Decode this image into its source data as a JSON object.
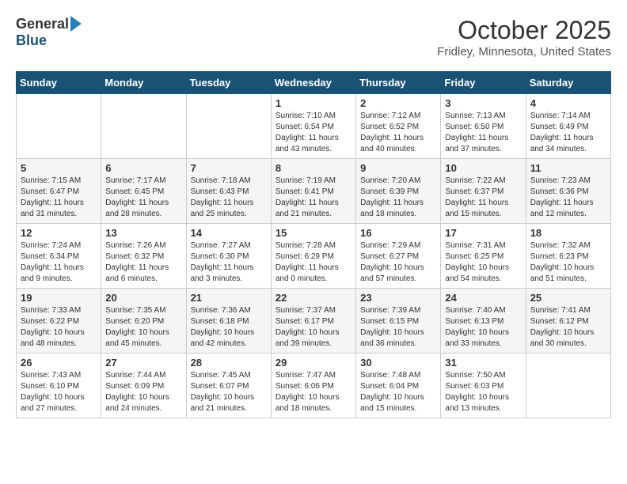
{
  "header": {
    "logo_general": "General",
    "logo_blue": "Blue",
    "month_title": "October 2025",
    "location": "Fridley, Minnesota, United States"
  },
  "days_of_week": [
    "Sunday",
    "Monday",
    "Tuesday",
    "Wednesday",
    "Thursday",
    "Friday",
    "Saturday"
  ],
  "weeks": [
    [
      {
        "day": "",
        "info": ""
      },
      {
        "day": "",
        "info": ""
      },
      {
        "day": "",
        "info": ""
      },
      {
        "day": "1",
        "info": "Sunrise: 7:10 AM\nSunset: 6:54 PM\nDaylight: 11 hours\nand 43 minutes."
      },
      {
        "day": "2",
        "info": "Sunrise: 7:12 AM\nSunset: 6:52 PM\nDaylight: 11 hours\nand 40 minutes."
      },
      {
        "day": "3",
        "info": "Sunrise: 7:13 AM\nSunset: 6:50 PM\nDaylight: 11 hours\nand 37 minutes."
      },
      {
        "day": "4",
        "info": "Sunrise: 7:14 AM\nSunset: 6:49 PM\nDaylight: 11 hours\nand 34 minutes."
      }
    ],
    [
      {
        "day": "5",
        "info": "Sunrise: 7:15 AM\nSunset: 6:47 PM\nDaylight: 11 hours\nand 31 minutes."
      },
      {
        "day": "6",
        "info": "Sunrise: 7:17 AM\nSunset: 6:45 PM\nDaylight: 11 hours\nand 28 minutes."
      },
      {
        "day": "7",
        "info": "Sunrise: 7:18 AM\nSunset: 6:43 PM\nDaylight: 11 hours\nand 25 minutes."
      },
      {
        "day": "8",
        "info": "Sunrise: 7:19 AM\nSunset: 6:41 PM\nDaylight: 11 hours\nand 21 minutes."
      },
      {
        "day": "9",
        "info": "Sunrise: 7:20 AM\nSunset: 6:39 PM\nDaylight: 11 hours\nand 18 minutes."
      },
      {
        "day": "10",
        "info": "Sunrise: 7:22 AM\nSunset: 6:37 PM\nDaylight: 11 hours\nand 15 minutes."
      },
      {
        "day": "11",
        "info": "Sunrise: 7:23 AM\nSunset: 6:36 PM\nDaylight: 11 hours\nand 12 minutes."
      }
    ],
    [
      {
        "day": "12",
        "info": "Sunrise: 7:24 AM\nSunset: 6:34 PM\nDaylight: 11 hours\nand 9 minutes."
      },
      {
        "day": "13",
        "info": "Sunrise: 7:26 AM\nSunset: 6:32 PM\nDaylight: 11 hours\nand 6 minutes."
      },
      {
        "day": "14",
        "info": "Sunrise: 7:27 AM\nSunset: 6:30 PM\nDaylight: 11 hours\nand 3 minutes."
      },
      {
        "day": "15",
        "info": "Sunrise: 7:28 AM\nSunset: 6:29 PM\nDaylight: 11 hours\nand 0 minutes."
      },
      {
        "day": "16",
        "info": "Sunrise: 7:29 AM\nSunset: 6:27 PM\nDaylight: 10 hours\nand 57 minutes."
      },
      {
        "day": "17",
        "info": "Sunrise: 7:31 AM\nSunset: 6:25 PM\nDaylight: 10 hours\nand 54 minutes."
      },
      {
        "day": "18",
        "info": "Sunrise: 7:32 AM\nSunset: 6:23 PM\nDaylight: 10 hours\nand 51 minutes."
      }
    ],
    [
      {
        "day": "19",
        "info": "Sunrise: 7:33 AM\nSunset: 6:22 PM\nDaylight: 10 hours\nand 48 minutes."
      },
      {
        "day": "20",
        "info": "Sunrise: 7:35 AM\nSunset: 6:20 PM\nDaylight: 10 hours\nand 45 minutes."
      },
      {
        "day": "21",
        "info": "Sunrise: 7:36 AM\nSunset: 6:18 PM\nDaylight: 10 hours\nand 42 minutes."
      },
      {
        "day": "22",
        "info": "Sunrise: 7:37 AM\nSunset: 6:17 PM\nDaylight: 10 hours\nand 39 minutes."
      },
      {
        "day": "23",
        "info": "Sunrise: 7:39 AM\nSunset: 6:15 PM\nDaylight: 10 hours\nand 36 minutes."
      },
      {
        "day": "24",
        "info": "Sunrise: 7:40 AM\nSunset: 6:13 PM\nDaylight: 10 hours\nand 33 minutes."
      },
      {
        "day": "25",
        "info": "Sunrise: 7:41 AM\nSunset: 6:12 PM\nDaylight: 10 hours\nand 30 minutes."
      }
    ],
    [
      {
        "day": "26",
        "info": "Sunrise: 7:43 AM\nSunset: 6:10 PM\nDaylight: 10 hours\nand 27 minutes."
      },
      {
        "day": "27",
        "info": "Sunrise: 7:44 AM\nSunset: 6:09 PM\nDaylight: 10 hours\nand 24 minutes."
      },
      {
        "day": "28",
        "info": "Sunrise: 7:45 AM\nSunset: 6:07 PM\nDaylight: 10 hours\nand 21 minutes."
      },
      {
        "day": "29",
        "info": "Sunrise: 7:47 AM\nSunset: 6:06 PM\nDaylight: 10 hours\nand 18 minutes."
      },
      {
        "day": "30",
        "info": "Sunrise: 7:48 AM\nSunset: 6:04 PM\nDaylight: 10 hours\nand 15 minutes."
      },
      {
        "day": "31",
        "info": "Sunrise: 7:50 AM\nSunset: 6:03 PM\nDaylight: 10 hours\nand 13 minutes."
      },
      {
        "day": "",
        "info": ""
      }
    ]
  ]
}
